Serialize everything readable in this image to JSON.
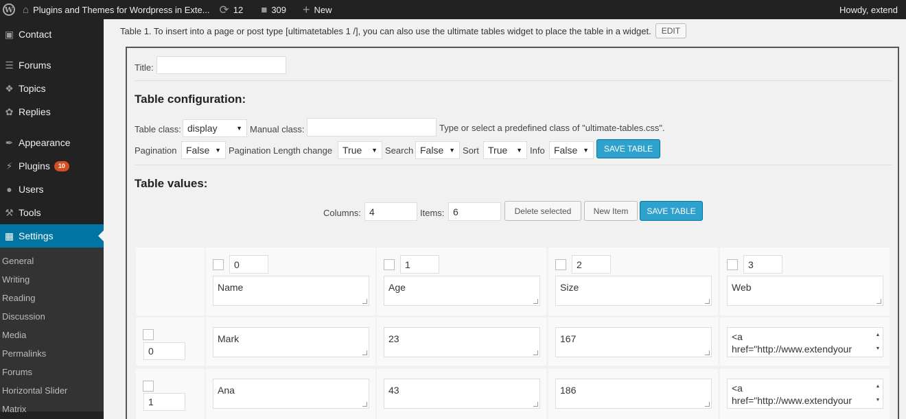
{
  "adminbar": {
    "site_title": "Plugins and Themes for Wordpress in Exte...",
    "updates_count": "12",
    "comments_count": "309",
    "new_label": "New",
    "greeting": "Howdy, extend"
  },
  "sidebar": {
    "items": [
      {
        "label": "Contact",
        "icon": "contact-icon"
      },
      {
        "label": "Forums",
        "icon": "forums-icon"
      },
      {
        "label": "Topics",
        "icon": "topics-icon"
      },
      {
        "label": "Replies",
        "icon": "replies-icon"
      },
      {
        "label": "Appearance",
        "icon": "appearance-icon"
      },
      {
        "label": "Plugins",
        "icon": "plugins-icon",
        "badge": "10"
      },
      {
        "label": "Users",
        "icon": "users-icon"
      },
      {
        "label": "Tools",
        "icon": "tools-icon"
      },
      {
        "label": "Settings",
        "icon": "settings-icon",
        "active": true
      }
    ],
    "submenu": [
      "General",
      "Writing",
      "Reading",
      "Discussion",
      "Media",
      "Permalinks",
      "Forums",
      "Horizontal Slider",
      "Matrix"
    ]
  },
  "intro": {
    "text": "Table 1. To insert into a page or post type [ultimatetables 1 /], you can also use the ultimate tables widget to place the table in a widget.",
    "edit_label": "EDIT"
  },
  "form": {
    "title_label": "Title:",
    "title_value": "",
    "config_heading": "Table configuration:",
    "table_class_label": "Table class:",
    "table_class_value": "display",
    "manual_class_label": "Manual class:",
    "manual_class_value": "",
    "manual_hint": "Type or select a predefined class of \"ultimate-tables.css\".",
    "pagination_label": "Pagination",
    "pagination_value": "False",
    "pag_length_label": "Pagination Length change",
    "pag_length_value": "True",
    "search_label": "Search",
    "search_value": "False",
    "sort_label": "Sort",
    "sort_value": "True",
    "info_label": "Info",
    "info_value": "False",
    "save_label": "SAVE TABLE",
    "values_heading": "Table values:",
    "columns_label": "Columns:",
    "columns_value": "4",
    "items_label": "Items:",
    "items_value": "6",
    "delete_label": "Delete selected",
    "new_item_label": "New Item",
    "save2_label": "SAVE TABLE"
  },
  "table": {
    "headers": [
      {
        "index": "0",
        "name": "Name"
      },
      {
        "index": "1",
        "name": "Age"
      },
      {
        "index": "2",
        "name": "Size"
      },
      {
        "index": "3",
        "name": "Web"
      }
    ],
    "rows": [
      {
        "index": "0",
        "cells": [
          "Mark",
          "23",
          "167",
          "<a\nhref=\"http://www.extendyour"
        ]
      },
      {
        "index": "1",
        "cells": [
          "Ana",
          "43",
          "186",
          "<a\nhref=\"http://www.extendyour"
        ]
      }
    ]
  }
}
